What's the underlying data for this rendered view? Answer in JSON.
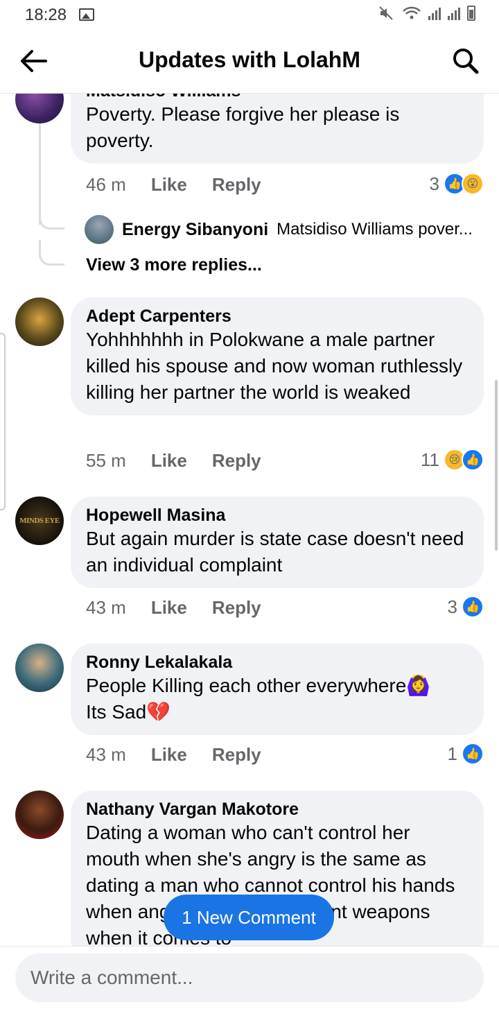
{
  "status_bar": {
    "time": "18:28"
  },
  "header": {
    "title": "Updates with LolahM"
  },
  "comments": [
    {
      "name": "Matsidiso Williams",
      "text": "Poverty. Please forgive her please is poverty.",
      "time": "46 m",
      "like": "Like",
      "reply": "Reply",
      "reactions_count": "3"
    },
    {
      "name": "Adept Carpenters",
      "text": "Yohhhhhhh in Polokwane a male partner killed his spouse and now woman ruthlessly killing her partner the world is weaked",
      "time": "55 m",
      "like": "Like",
      "reply": "Reply",
      "reactions_count": "11"
    },
    {
      "name": "Hopewell Masina",
      "text": "But again murder is state case doesn't need an individual complaint",
      "time": "43 m",
      "like": "Like",
      "reply": "Reply",
      "reactions_count": "3",
      "avatar_text": "MINDS EYE"
    },
    {
      "name": "Ronny Lekalakala",
      "text": "People Killing each other everywhere🙆‍♀️",
      "text2": "Its Sad💔",
      "time": "43 m",
      "like": "Like",
      "reply": "Reply",
      "reactions_count": "1"
    },
    {
      "name": "Nathany Vargan Makotore",
      "text": "Dating a woman who can't control her mouth when she's angry is the same as dating a man who cannot control his hands when angry. We have different weapons when it comes to"
    }
  ],
  "reply_preview": {
    "name": "Energy Sibanyoni",
    "text": "Matsidiso Williams pover..."
  },
  "view_more": "View 3 more replies...",
  "new_comment": "1 New Comment",
  "composer": {
    "placeholder": "Write a comment..."
  },
  "colors": {
    "accent": "#1877f2",
    "bubble": "#f0f2f5",
    "muted": "#65676b"
  }
}
